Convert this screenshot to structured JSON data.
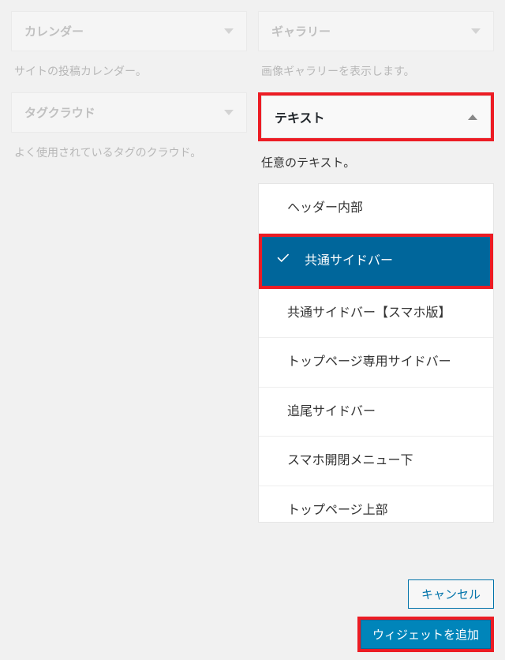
{
  "left": {
    "calendar": {
      "title": "カレンダー",
      "desc": "サイトの投稿カレンダー。"
    },
    "tagcloud": {
      "title": "タグクラウド",
      "desc": "よく使用されているタグのクラウド。"
    }
  },
  "right": {
    "gallery": {
      "title": "ギャラリー",
      "desc": "画像ギャラリーを表示します。"
    },
    "text": {
      "title": "テキスト",
      "desc": "任意のテキスト。"
    }
  },
  "areas": [
    {
      "label": "ヘッダー内部",
      "selected": false
    },
    {
      "label": "共通サイドバー",
      "selected": true
    },
    {
      "label": "共通サイドバー【スマホ版】",
      "selected": false
    },
    {
      "label": "トップページ専用サイドバー",
      "selected": false
    },
    {
      "label": "追尾サイドバー",
      "selected": false
    },
    {
      "label": "スマホ開閉メニュー下",
      "selected": false
    },
    {
      "label": "トップページ上部",
      "selected": false
    }
  ],
  "buttons": {
    "cancel": "キャンセル",
    "add": "ウィジェットを追加"
  }
}
